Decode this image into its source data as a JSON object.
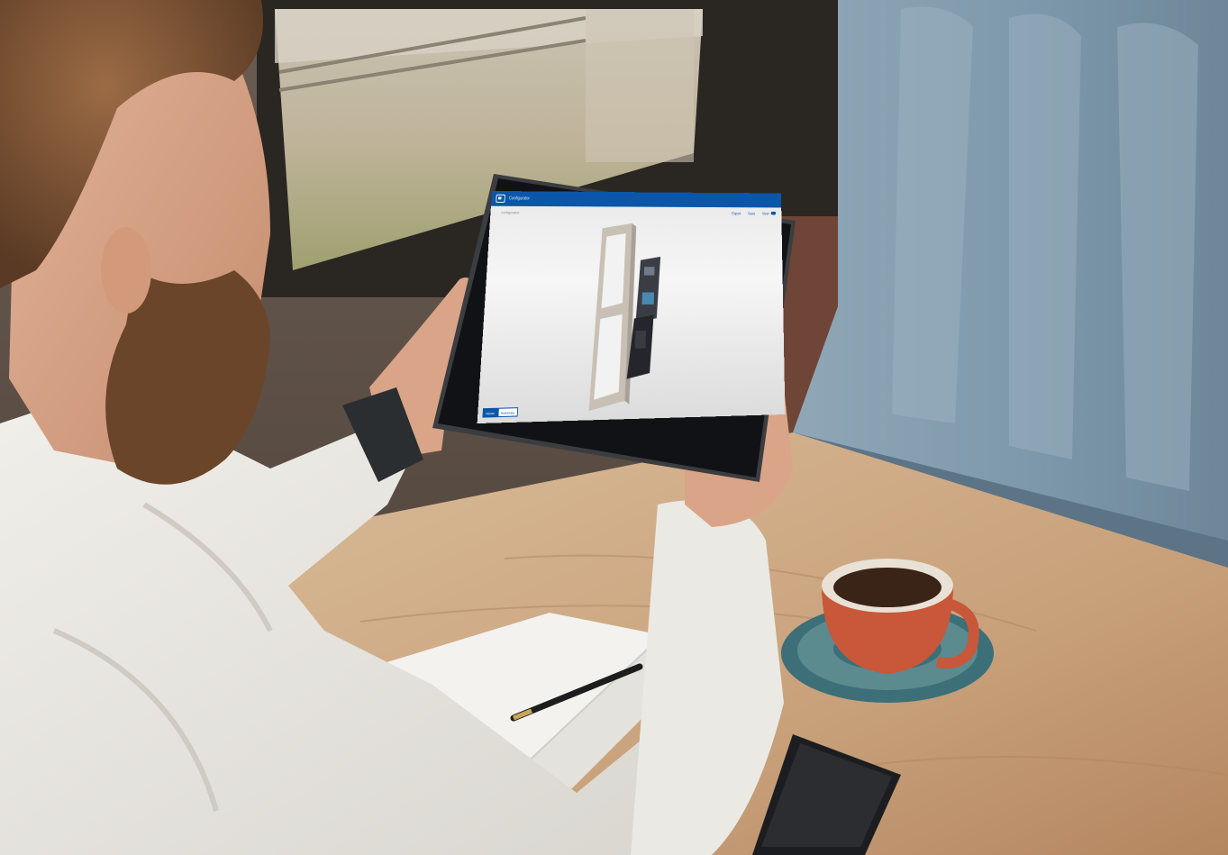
{
  "scene": {
    "description_tags": [
      "person-with-tablet",
      "cafe-table",
      "coffee-cup",
      "notebook",
      "pen",
      "smartphone",
      "window",
      "sofa"
    ]
  },
  "tablet_ui": {
    "app_title": "Configurator",
    "breadcrumb": "Configuration",
    "actions": [
      {
        "label": "Export"
      },
      {
        "label": "Save"
      },
      {
        "label": "View"
      }
    ],
    "buttons": [
      {
        "label": "Home"
      },
      {
        "label": "Summary"
      }
    ]
  },
  "colors": {
    "accent": "#0b56a8",
    "wood": "#c9a27c",
    "sofa": "#7f9aad",
    "cup": "#c9573a",
    "saucer": "#3c6f77",
    "shirt": "#e7e5e0"
  }
}
